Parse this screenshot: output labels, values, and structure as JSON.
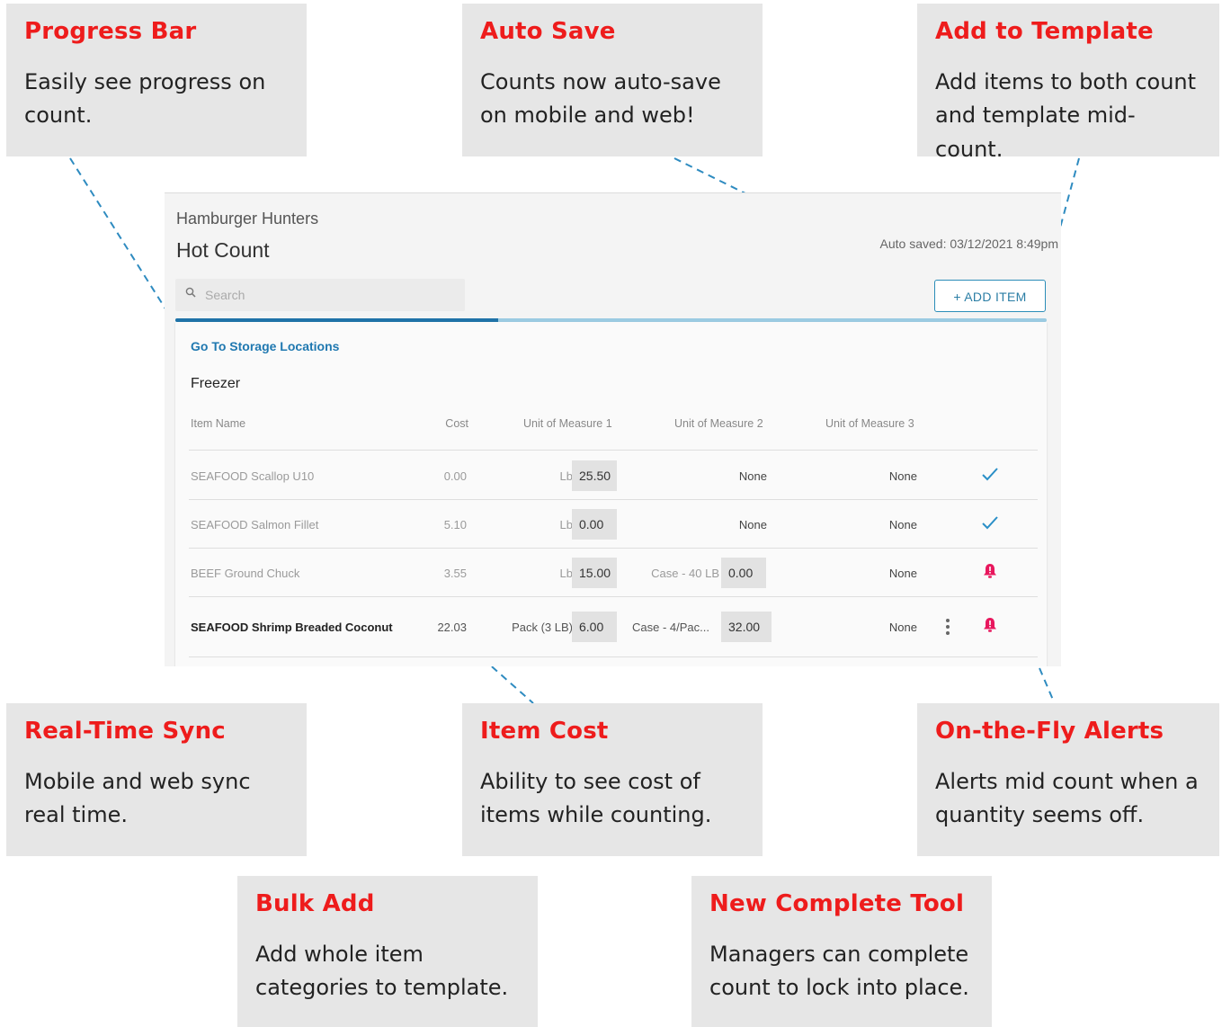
{
  "callouts": [
    {
      "title": "Progress Bar",
      "body": "Easily see progress on count."
    },
    {
      "title": "Auto Save",
      "body": "Counts now auto-save on mobile and web!"
    },
    {
      "title": "Add to Template",
      "body": "Add items to both count and template mid-count."
    },
    {
      "title": "Real-Time Sync",
      "body": "Mobile and web sync real time."
    },
    {
      "title": "Item Cost",
      "body": "Ability to see cost of items while counting."
    },
    {
      "title": "On-the-Fly Alerts",
      "body": "Alerts mid count when a quantity seems off."
    },
    {
      "title": "Bulk Add",
      "body": "Add whole item categories to template."
    },
    {
      "title": "New Complete Tool",
      "body": "Managers can complete count to lock into place."
    }
  ],
  "app": {
    "account": "Hamburger Hunters",
    "count_title": "Hot Count",
    "autosaved": "Auto saved: 03/12/2021 8:49pm",
    "search_placeholder": "Search",
    "add_item_label": "+ ADD ITEM",
    "progress_fraction": 0.37,
    "goto_label": "Go To Storage Locations",
    "section": "Freezer",
    "columns": [
      "Item Name",
      "Cost",
      "Unit of Measure 1",
      "Unit of Measure 2",
      "Unit of Measure 3"
    ],
    "rows": [
      {
        "name": "SEAFOOD Scallop U10",
        "cost": "0.00",
        "uom1_unit": "Lb",
        "uom1_value": "25.50",
        "uom2_text": "None",
        "uom3": "None",
        "status": "check"
      },
      {
        "name": "SEAFOOD Salmon Fillet",
        "cost": "5.10",
        "uom1_unit": "Lb",
        "uom1_value": "0.00",
        "uom2_text": "None",
        "uom3": "None",
        "status": "check"
      },
      {
        "name": "BEEF Ground Chuck",
        "cost": "3.55",
        "uom1_unit": "Lb",
        "uom1_value": "15.00",
        "uom2_unit": "Case - 40 LB",
        "uom2_value": "0.00",
        "uom3": "None",
        "status": "alert"
      },
      {
        "name": "SEAFOOD Shrimp Breaded Coconut",
        "cost": "22.03",
        "uom1_unit": "Pack (3 LB)",
        "uom1_value": "6.00",
        "uom2_unit": "Case - 4/Pac...",
        "uom2_value": "32.00",
        "uom3": "None",
        "status": "alert"
      }
    ],
    "colors": {
      "accent": "#1f73a8",
      "alert": "#e8175d",
      "check": "#2a8fc7",
      "callout_title": "#ee1c1c"
    }
  }
}
